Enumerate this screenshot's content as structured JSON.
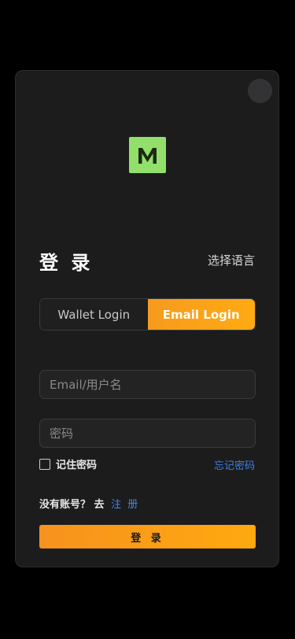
{
  "icons": {
    "close": "close-icon",
    "logo": "brand-m-logo"
  },
  "colors": {
    "accent": "#f7921e",
    "link": "#3d7fe6",
    "logo": "#92e06b",
    "background": "#000000",
    "card": "#1c1c1d"
  },
  "login": {
    "title": "登 录",
    "language_label": "选择语言",
    "tabs": [
      {
        "label": "Wallet Login",
        "active": false
      },
      {
        "label": "Email Login",
        "active": true
      }
    ],
    "email_placeholder": "Email/用户名",
    "password_placeholder": "密码",
    "remember_label": "记住密码",
    "forgot_label": "忘记密码",
    "no_account_text": "没有账号？ 去",
    "register_label": "注 册",
    "submit_label": "登 录"
  }
}
